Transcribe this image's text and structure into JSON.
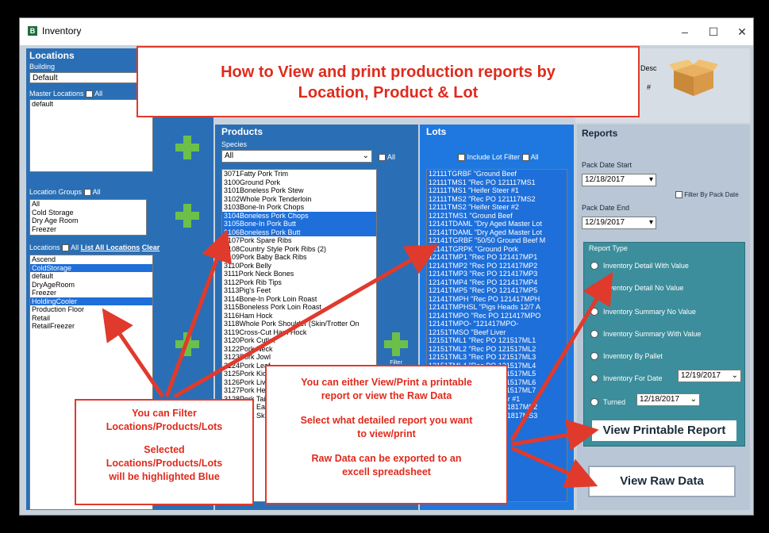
{
  "window": {
    "title": "Inventory",
    "minimize": "–",
    "maximize": "☐",
    "close": "✕"
  },
  "banner": {
    "line1": "How to View and print production reports by",
    "line2": "Location, Product & Lot"
  },
  "top_right": {
    "desc_label": "Desc",
    "hash_label": "#"
  },
  "locations": {
    "header": "Locations",
    "building_label": "Building",
    "building_value": "Default",
    "master_label": "Master Locations",
    "all_label": "All",
    "master_items": [
      "default"
    ],
    "groups_label": "Location Groups",
    "groups_items": [
      "All",
      "Cold Storage",
      "Dry Age Room",
      "Freezer"
    ],
    "locations_label": "Locations",
    "list_all_label": "List All Locations",
    "clear_label": "Clear",
    "location_items": [
      {
        "name": "Ascend",
        "selected": false
      },
      {
        "name": "ColdStorage",
        "selected": true
      },
      {
        "name": "default",
        "selected": false
      },
      {
        "name": "DryAgeRoom",
        "selected": false
      },
      {
        "name": "Freezer",
        "selected": false
      },
      {
        "name": "HoldingCooler",
        "selected": true
      },
      {
        "name": "Production Floor",
        "selected": false
      },
      {
        "name": "Retail",
        "selected": false
      },
      {
        "name": "RetailFreezer",
        "selected": false
      }
    ]
  },
  "products": {
    "header": "Products",
    "species_label": "Species",
    "species_value": "All",
    "all_label": "All",
    "filter_label": "Filter Selected Products Ann",
    "items": [
      {
        "name": "3071Fatty Pork Trim",
        "selected": false
      },
      {
        "name": "3100Ground Pork",
        "selected": false
      },
      {
        "name": "3101Boneless Pork Stew",
        "selected": false
      },
      {
        "name": "3102Whole Pork Tenderloin",
        "selected": false
      },
      {
        "name": "3103Bone-In Pork Chops",
        "selected": false
      },
      {
        "name": "3104Boneless Pork Chops",
        "selected": true
      },
      {
        "name": "3105Bone-In Pork Butt",
        "selected": true
      },
      {
        "name": "3106Boneless Pork Butt",
        "selected": true
      },
      {
        "name": "3107Pork Spare Ribs",
        "selected": false
      },
      {
        "name": "3108Country Style Pork Ribs (2)",
        "selected": false
      },
      {
        "name": "3109Pork Baby Back Ribs",
        "selected": false
      },
      {
        "name": "3110Pork Belly",
        "selected": false
      },
      {
        "name": "3111Pork Neck Bones",
        "selected": false
      },
      {
        "name": "3112Pork Rib Tips",
        "selected": false
      },
      {
        "name": "3113Pig's Feet",
        "selected": false
      },
      {
        "name": "3114Bone-In Pork Loin Roast",
        "selected": false
      },
      {
        "name": "3115Boneless Pork Loin Roast",
        "selected": false
      },
      {
        "name": "3116Ham Hock",
        "selected": false
      },
      {
        "name": "3118Whole Pork Shoulder (Skin/Trotter On",
        "selected": false
      },
      {
        "name": "3119Cross-Cut Ham Hock",
        "selected": false
      },
      {
        "name": "3120Pork Cutlet",
        "selected": false
      },
      {
        "name": "3122Pork Neck",
        "selected": false
      },
      {
        "name": "3123Pork Jowl",
        "selected": false
      },
      {
        "name": "3124Pork Leaf",
        "selected": false
      },
      {
        "name": "3125Pork Kidney",
        "selected": false
      },
      {
        "name": "3126Pork Liver",
        "selected": false
      },
      {
        "name": "3127Pork Heart",
        "selected": false
      },
      {
        "name": "3128Pork Tail",
        "selected": false
      },
      {
        "name": "3129Pork Ear",
        "selected": false
      },
      {
        "name": "3130Pork Skin",
        "selected": false
      }
    ]
  },
  "lots": {
    "header": "Lots",
    "include_label": "Include Lot Filter",
    "all_label": "All",
    "items": [
      "12111TGRBF \"Ground Beef",
      "12111TMS1 \"Rec PO 121117MS1",
      "12111TMS1 \"Heifer Steer #1",
      "12111TMS2 \"Rec PO 121117MS2",
      "12111TMS2 \"Heifer Steer #2",
      "12121TMS1 \"Ground Beef",
      "12141TDAML \"Dry Aged Master Lot",
      "12141TDAML \"Dry Aged Master Lot",
      "12141TGRBF \"50/50 Ground Beef M",
      "12141TGRPK \"Ground Pork",
      "12141TMP1 \"Rec PO 121417MP1",
      "12141TMP2 \"Rec PO 121417MP2",
      "12141TMP3 \"Rec PO 121417MP3",
      "12141TMP4 \"Rec PO 121417MP4",
      "12141TMP5 \"Rec PO 121417MP5",
      "12141TMPH \"Rec PO 121417MPH",
      "12141TMPHSL \"Pigs Heads 12/7 A",
      "12141TMPO \"Rec PO 121417MPO",
      "12141TMPO- \"121417MPO-",
      "12151TMSO \"Beef Liver",
      "12151TML1 \"Rec PO 121517ML1",
      "12151TML2 \"Rec PO 121517ML2",
      "12151TML3 \"Rec PO 121517ML3",
      "12151TML4 \"Rec PO 121517ML4",
      "12151TML5 \"Rec PO 121517ML5",
      "12151TML6 \"Rec PO 121517ML6",
      "12151TML7 \"Rec PO 121517ML7",
      "12181TMS1 \"Heifer Steer #1",
      "12181TMS2 \"Rec PO 121817MS2",
      "12181TMS3 \"Rec PO 121817MS3"
    ]
  },
  "reports": {
    "header": "Reports",
    "pack_start_label": "Pack Date Start",
    "pack_start_value": "12/18/2017",
    "pack_end_label": "Pack Date End",
    "pack_end_value": "12/19/2017",
    "filter_by_pack": "Filter By Pack Date",
    "report_type_label": "Report Type",
    "options": [
      {
        "label": "Inventory Detail With Value",
        "checked": false
      },
      {
        "label": "Inventory Detail No Value",
        "checked": true
      },
      {
        "label": "Inventory Summary No Value",
        "checked": false
      },
      {
        "label": "Inventory Summary With Value",
        "checked": false
      },
      {
        "label": "Inventory By Pallet",
        "checked": false
      },
      {
        "label": "Inventory For Date",
        "checked": false
      },
      {
        "label": "Turned",
        "checked": false
      }
    ],
    "for_date_value": "12/19/2017",
    "turned_value": "12/18/2017",
    "view_printable": "View Printable Report",
    "view_raw": "View Raw Data"
  },
  "callouts": {
    "filter": {
      "l1": "You can Filter",
      "l2": "Locations/Products/Lots",
      "l3": "Selected",
      "l4": "Locations/Products/Lots",
      "l5": "will be highlighted Blue"
    },
    "view": {
      "l1": "You can either View/Print a printable",
      "l2": "report or view the Raw Data",
      "l3": "Select what detailed report you want",
      "l4": "to view/print",
      "l5": "Raw Data can be exported to an",
      "l6": "excell spreadsheet"
    }
  },
  "colors": {
    "accent_red": "#e03a2c",
    "panel_blue": "#2a6fb5",
    "lots_blue": "#1e78e0",
    "teal": "#3c8e9c"
  }
}
